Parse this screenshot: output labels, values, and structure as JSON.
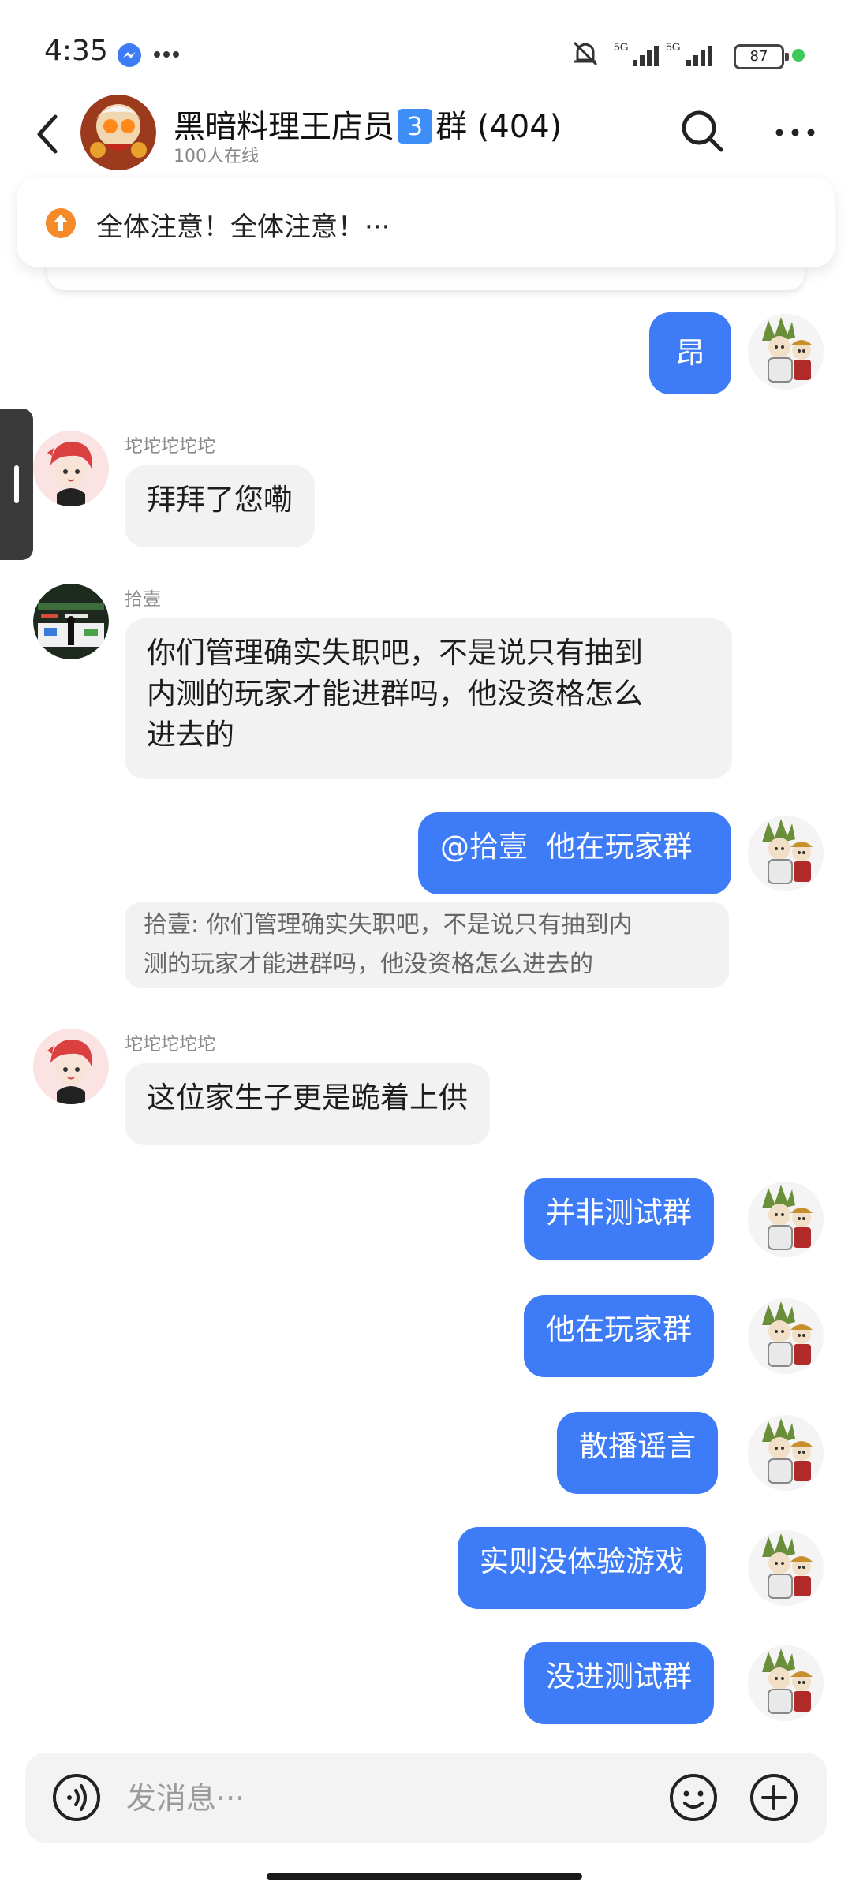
{
  "status": {
    "time": "4:35",
    "battery": "87",
    "signal_label": "5G"
  },
  "header": {
    "title_prefix": "黑暗料理王店员",
    "title_num": "3",
    "title_suffix": "群 (404)",
    "online": "100人在线"
  },
  "notice": {
    "text": "全体注意！全体注意！···"
  },
  "messages": [
    {
      "side": "out",
      "text": "昂"
    },
    {
      "side": "in",
      "sender": "坨坨坨坨坨",
      "text": "拜拜了您嘞"
    },
    {
      "side": "in",
      "sender": "拾壹",
      "lines": [
        "你们管理确实失职吧，不是说只有抽到",
        "内测的玩家才能进群吗，他没资格怎么",
        "进去的"
      ]
    },
    {
      "side": "out",
      "text": "@拾壹  他在玩家群"
    },
    {
      "side": "quote",
      "lines": [
        "拾壹: 你们管理确实失职吧，不是说只有抽到内",
        "测的玩家才能进群吗，他没资格怎么进去的"
      ]
    },
    {
      "side": "in",
      "sender": "坨坨坨坨坨",
      "text": "这位家生子更是跪着上供"
    },
    {
      "side": "out",
      "text": "并非测试群"
    },
    {
      "side": "out",
      "text": "他在玩家群"
    },
    {
      "side": "out",
      "text": "散播谣言"
    },
    {
      "side": "out",
      "text": "实则没体验游戏"
    },
    {
      "side": "out",
      "text": "没进测试群"
    }
  ],
  "input": {
    "placeholder": "发消息···"
  },
  "colors": {
    "accent": "#3d7cf6",
    "bubble_in": "#f2f2f2",
    "notice_icon": "#f58a2a"
  }
}
